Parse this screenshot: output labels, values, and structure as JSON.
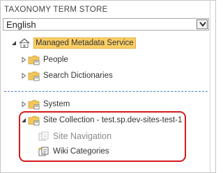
{
  "panel": {
    "title": "TAXONOMY TERM STORE"
  },
  "language": {
    "selected": "English"
  },
  "tree": {
    "root": {
      "label": "Managed Metadata Service",
      "icon": "home-icon",
      "expanded": true
    },
    "groups": [
      {
        "label": "People",
        "icon": "folder-icon"
      },
      {
        "label": "Search Dictionaries",
        "icon": "folder-icon"
      },
      {
        "label": "System",
        "icon": "folder-icon"
      },
      {
        "label": "Site Collection - test.sp.dev-sites-test-1",
        "icon": "folder-icon",
        "expanded": true
      }
    ],
    "term_sets": [
      {
        "label": "Site Navigation",
        "icon": "navigation-term-set-icon",
        "disabled": true
      },
      {
        "label": "Wiki Categories",
        "icon": "term-set-icon"
      }
    ]
  },
  "colors": {
    "selection_fill": "#fbcf66",
    "selection_border": "#e7ad35",
    "divider": "#4b86c2",
    "callout": "#d41a1a",
    "folder": "#f2c65a"
  }
}
